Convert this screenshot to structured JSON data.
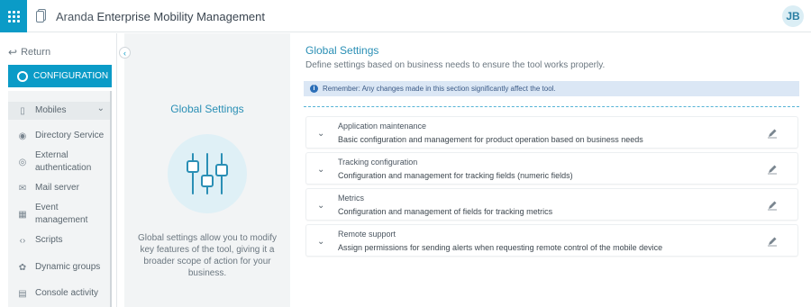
{
  "header": {
    "brand_prefix": "Aranda",
    "brand_name": "Enterprise Mobility Management",
    "avatar": "JB",
    "accent": "#0b9bc7"
  },
  "sidebar": {
    "return_label": "Return",
    "config_label": "CONFIGURATION",
    "items": [
      {
        "label": "Mobiles",
        "icon": "mobile-icon"
      },
      {
        "label": "Directory Service",
        "icon": "users-icon"
      },
      {
        "label": "External authentication",
        "icon": "fingerprint-icon"
      },
      {
        "label": "Mail server",
        "icon": "mail-icon"
      },
      {
        "label": "Event management",
        "icon": "calendar-icon"
      },
      {
        "label": "Scripts",
        "icon": "code-icon"
      },
      {
        "label": "Dynamic groups",
        "icon": "groups-icon"
      },
      {
        "label": "Console activity",
        "icon": "activity-icon"
      }
    ]
  },
  "panel": {
    "title": "Global Settings",
    "description": "Global settings allow you to modify key features of the tool, giving it a broader scope of action for your business."
  },
  "main": {
    "title": "Global Settings",
    "subtitle": "Define settings based on business needs to ensure the tool works properly.",
    "notice": "Remember: Any changes made in this section significantly affect the tool.",
    "sections": [
      {
        "title": "Application maintenance",
        "description": "Basic configuration and management for product operation based on business needs"
      },
      {
        "title": "Tracking configuration",
        "description": "Configuration and management for tracking fields (numeric fields)"
      },
      {
        "title": "Metrics",
        "description": "Configuration and management of fields for tracking metrics"
      },
      {
        "title": "Remote support",
        "description": "Assign permissions for sending alerts when requesting remote control of the mobile device"
      }
    ]
  }
}
